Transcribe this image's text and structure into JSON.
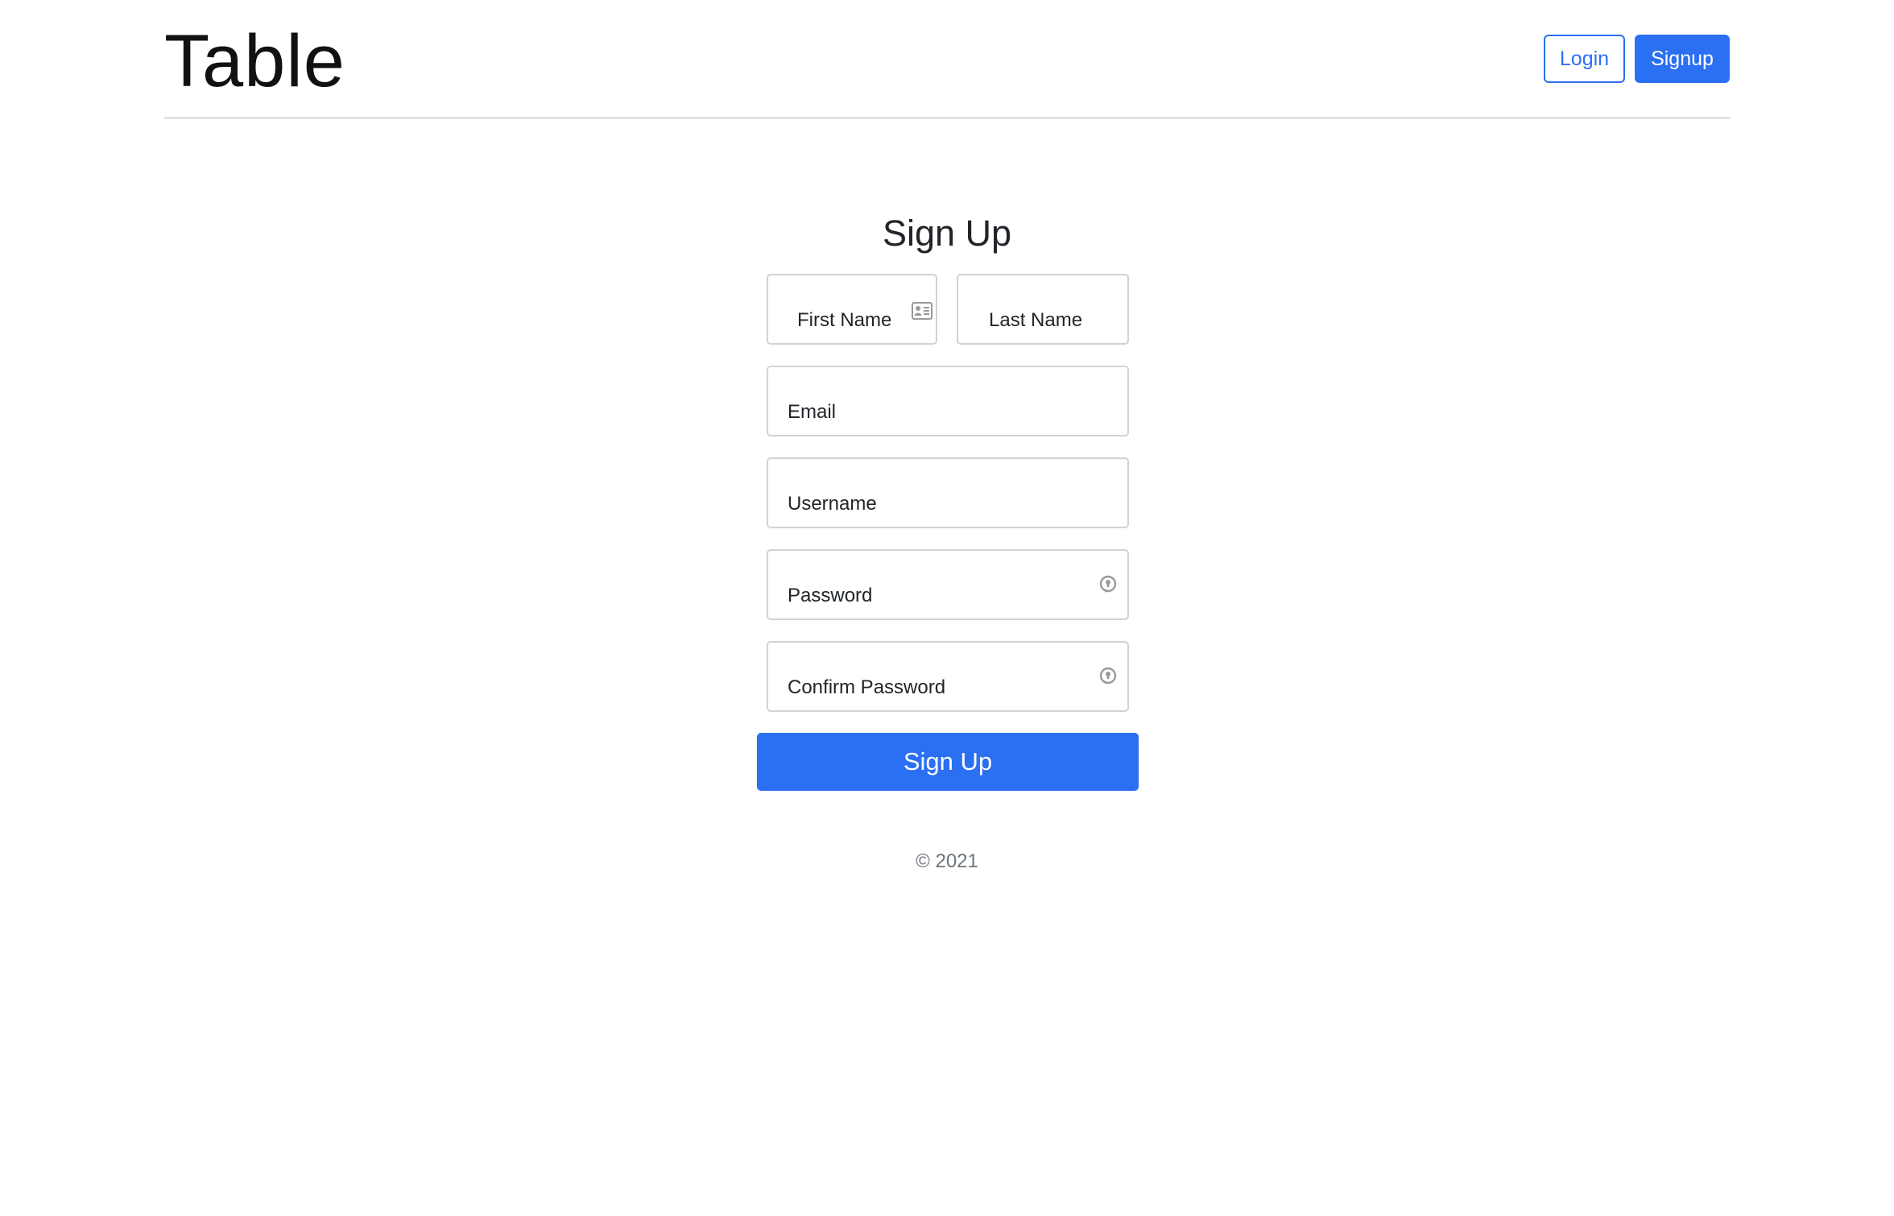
{
  "header": {
    "brand": "Table",
    "login_label": "Login",
    "signup_label": "Signup"
  },
  "form": {
    "title": "Sign Up",
    "first_name_placeholder": "First Name",
    "last_name_placeholder": "Last Name",
    "email_placeholder": "Email",
    "username_placeholder": "Username",
    "password_placeholder": "Password",
    "confirm_password_placeholder": "Confirm Password",
    "submit_label": "Sign Up"
  },
  "footer": {
    "text": "© 2021"
  },
  "icons": {
    "first_name": "id-card-icon",
    "password": "password-key-icon",
    "confirm_password": "password-key-icon"
  },
  "colors": {
    "primary": "#2b6ff2",
    "border": "#cfd3d7",
    "muted": "#6c757d"
  }
}
